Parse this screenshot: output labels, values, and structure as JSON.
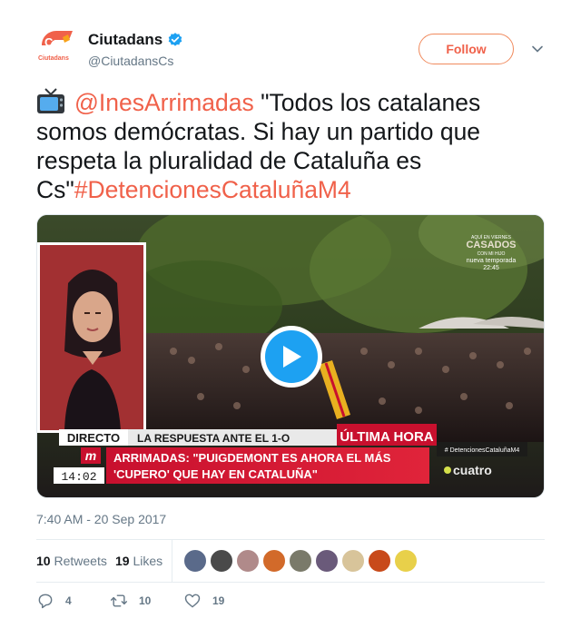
{
  "account": {
    "name": "Ciutadans",
    "handle": "@CiutadansCs",
    "follow_label": "Follow",
    "logo_text": "Cs",
    "logo_sub": "Ciutadans"
  },
  "tweet": {
    "mention": "@InesArrimadas",
    "body": " \"Todos los catalanes somos demócratas. Si hay un partido que respeta la pluralidad de Cataluña es Cs\"",
    "hashtag": "#DetencionesCataluñaM4",
    "timestamp": "7:40 AM - 20 Sep 2017"
  },
  "video": {
    "live_label": "DIRECTO",
    "topic": "LA RESPUESTA ANTE EL 1-O",
    "breaking": "ÚLTIMA HORA",
    "headline_line1": "ARRIMADAS: \"PUIGDEMONT ES AHORA EL MÁS",
    "headline_line2": "'CUPERO' QUE HAY EN CATALUÑA\"",
    "clock": "14:02",
    "hashtag": "# DetencionesCataluñaM4",
    "channel": "cuatro",
    "promo_line1": "AQUÍ EN VIERNES",
    "promo_line2": "CASADOS",
    "promo_line3": "CON MI HIJO",
    "promo_line4": "nueva temporada",
    "promo_line5": "22:45",
    "network_logo": "m"
  },
  "stats": {
    "retweets_count": "10",
    "retweets_label": "Retweets",
    "likes_count": "19",
    "likes_label": "Likes"
  },
  "actions": {
    "replies": "4",
    "retweets": "10",
    "likes": "19"
  },
  "colors": {
    "brand": "#f0614a",
    "link": "#f0614a",
    "play": "#1da1f2",
    "verified": "#1da1f2"
  },
  "icons": [
    "verified-icon",
    "chevron-down-icon",
    "tv-icon",
    "play-icon",
    "reply-icon",
    "retweet-icon",
    "heart-icon"
  ]
}
